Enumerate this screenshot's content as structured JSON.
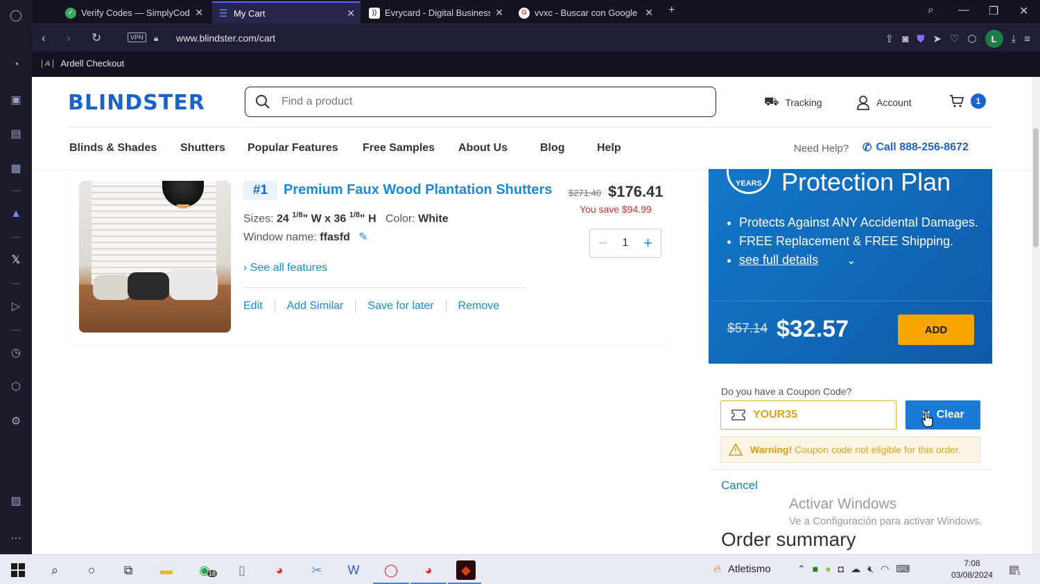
{
  "browser": {
    "tabs": [
      {
        "label": "Verify Codes — SimplyCodes",
        "active": false,
        "favicon_color": "#3aa757"
      },
      {
        "label": "My Cart",
        "active": true,
        "favicon_color": "#1a63c9"
      },
      {
        "label": "Evrycard - Digital Business",
        "active": false,
        "favicon_color": "#222222"
      },
      {
        "label": "vvxc - Buscar con Google",
        "active": false,
        "favicon_color": "#ea4335"
      }
    ],
    "new_tab": "+",
    "vpn_label": "VPN",
    "url": "www.blindster.com/cart",
    "profile_initial": "L",
    "bookmark": "Ardell Checkout",
    "bookmark_logo": "A"
  },
  "site": {
    "logo_text": "BLINDSTER",
    "search_placeholder": "Find a product",
    "tracking": "Tracking",
    "account": "Account",
    "cart_count": "1",
    "menu": [
      "Blinds & Shades",
      "Shutters",
      "Popular Features",
      "Free Samples",
      "About Us",
      "Blog",
      "Help"
    ],
    "need_help": "Need Help?",
    "phone": "Call 888-256-8672"
  },
  "cart_item": {
    "number": "#1",
    "title": "Premium Faux Wood Plantation Shutters",
    "old_price": "$271.40",
    "price": "$176.41",
    "you_save": "You save $94.99",
    "sizes_label": "Sizes:",
    "width_whole": "24",
    "width_frac": "1/8",
    "width_unit": "\" W x 36",
    "height_frac": "1/8",
    "height_unit": "\" H",
    "color_label": "Color:",
    "color_value": "White",
    "window_label": "Window name:",
    "window_value": "ffasfd",
    "quantity": "1",
    "see_all": "See all features",
    "actions": [
      "Edit",
      "Add Similar",
      "Save for later",
      "Remove"
    ]
  },
  "protection_plan": {
    "badge": "YEARS",
    "title": "Protection Plan",
    "bullets": [
      "Protects Against ANY Accidental Damages.",
      "FREE Replacement & FREE Shipping."
    ],
    "details_link": "see full details",
    "old_price": "$57.14",
    "price": "$32.57",
    "add_label": "ADD"
  },
  "coupon": {
    "label": "Do you have a Coupon Code?",
    "code": "YOUR35",
    "clear_label": "Clear",
    "warning_strong": "Warning!",
    "warning_text": "Coupon code not eligible for this order.",
    "cancel": "Cancel"
  },
  "order_summary": {
    "title": "Order summary"
  },
  "watermark": {
    "line1": "Activar Windows",
    "line2": "Ve a Configuración para activar Windows."
  },
  "taskbar": {
    "whatsapp_badge": "18",
    "weather_label": "Atletismo",
    "time": "7:08",
    "date": "03/08/2024",
    "notifications": "5"
  }
}
